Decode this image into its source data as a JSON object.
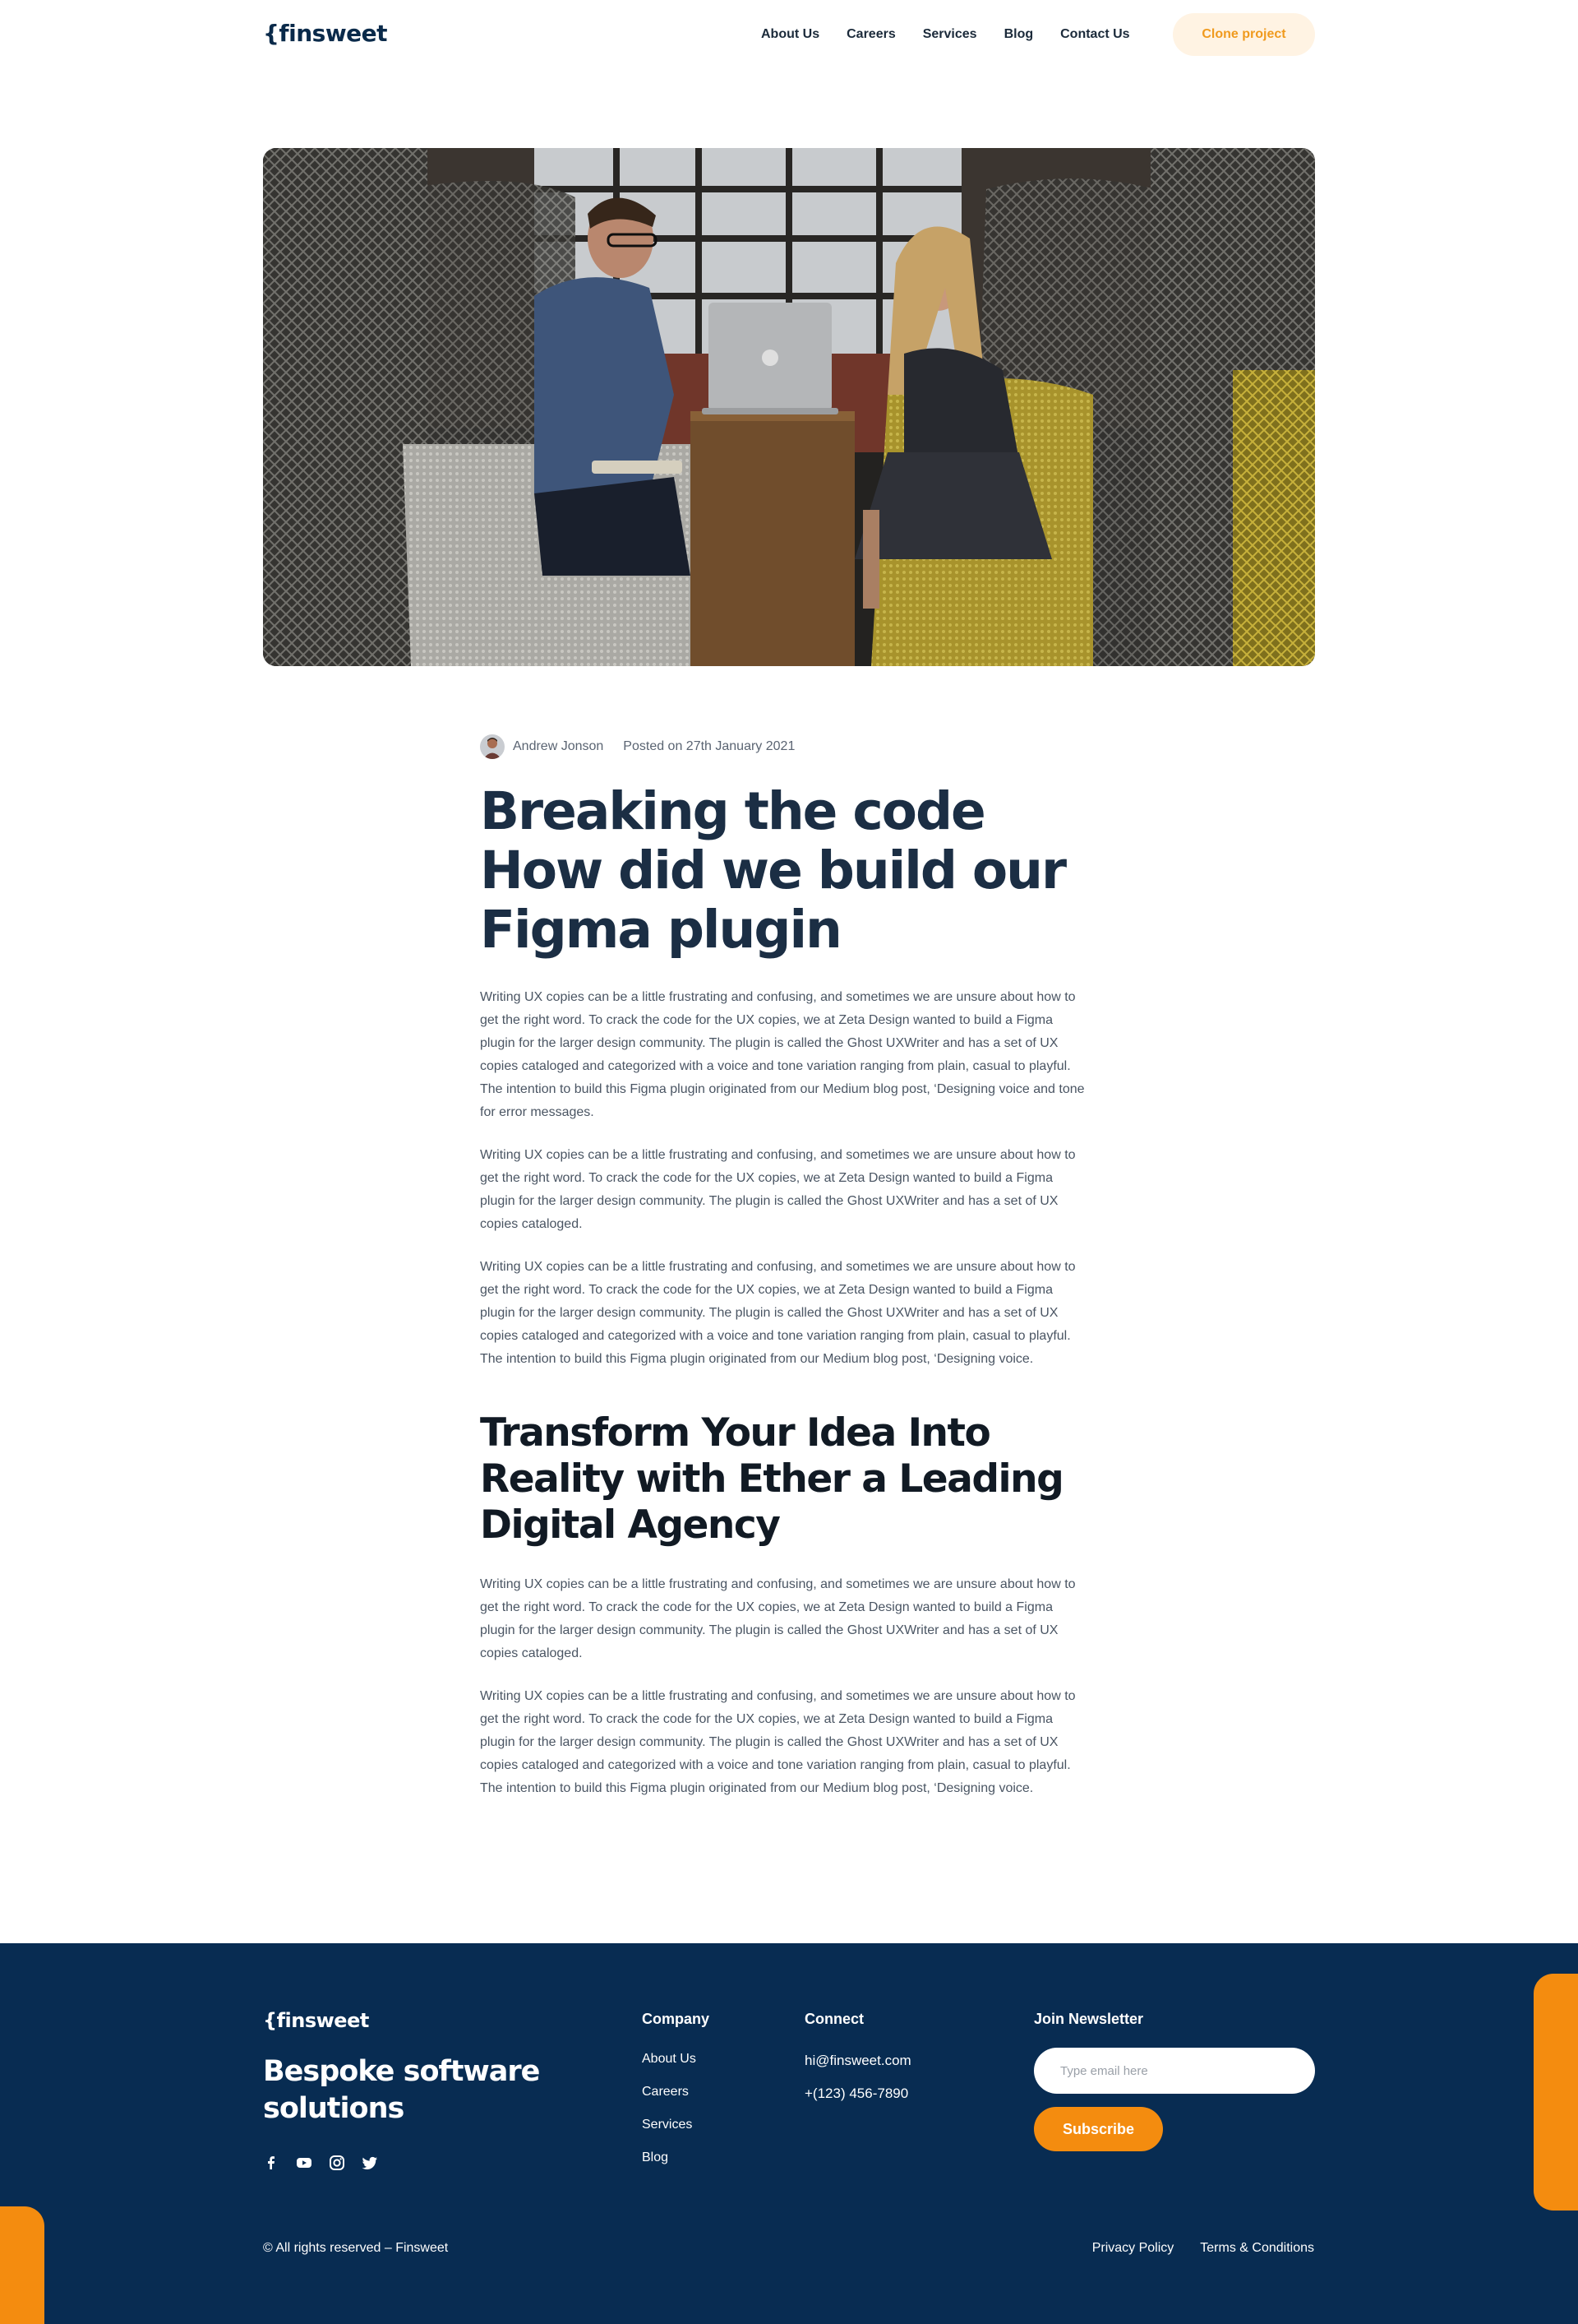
{
  "header": {
    "logo": "{finsweet",
    "nav": [
      "About Us",
      "Careers",
      "Services",
      "Blog",
      "Contact Us"
    ],
    "cta": "Clone project"
  },
  "hero": {
    "description": "photo"
  },
  "article": {
    "author": "Andrew Jonson",
    "posted": "Posted on 27th January 2021",
    "title": "Breaking the code How did we build our Figma plugin",
    "paragraphs": [
      "Writing UX copies can be a little frustrating and confusing, and sometimes we are unsure about how to get the right word. To crack the code for the UX copies, we at Zeta Design wanted to build a Figma plugin for the larger design community. The plugin is called the Ghost UXWriter and has a set of UX copies cataloged and categorized with a voice and tone variation ranging from plain, casual to playful. The intention to build this Figma plugin originated from our Medium blog post, ‘Designing voice and tone for error messages.",
      "Writing UX copies can be a little frustrating and confusing, and sometimes we are unsure about how to get the right word. To crack the code for the UX copies, we at Zeta Design wanted to build a Figma plugin for the larger design community. The plugin is called the Ghost UXWriter and has a set of UX copies cataloged.",
      "Writing UX copies can be a little frustrating and confusing, and sometimes we are unsure about how to get the right word. To crack the code for the UX copies, we at Zeta Design wanted to build a Figma plugin for the larger design community. The plugin is called the Ghost UXWriter and has a set of UX copies cataloged and categorized with a voice and tone variation ranging from plain, casual to playful. The intention to build this Figma plugin originated from our Medium blog post, ‘Designing voice."
    ],
    "subtitle": "Transform Your Idea Into Reality with Ether a Leading Digital Agency",
    "paragraphs2": [
      "Writing UX copies can be a little frustrating and confusing, and sometimes we are unsure about how to get the right word. To crack the code for the UX copies, we at Zeta Design wanted to build a Figma plugin for the larger design community. The plugin is called the Ghost UXWriter and has a set of UX copies cataloged.",
      "Writing UX copies can be a little frustrating and confusing, and sometimes we are unsure about how to get the right word. To crack the code for the UX copies, we at Zeta Design wanted to build a Figma plugin for the larger design community. The plugin is called the Ghost UXWriter and has a set of UX copies cataloged and categorized with a voice and tone variation ranging from plain, casual to playful. The intention to build this Figma plugin originated from our Medium blog post, ‘Designing voice."
    ]
  },
  "footer": {
    "logo": "{finsweet",
    "tagline": "Bespoke software solutions",
    "socials": [
      "facebook-icon",
      "youtube-icon",
      "instagram-icon",
      "twitter-icon"
    ],
    "company": {
      "heading": "Company",
      "links": [
        "About Us",
        "Careers",
        "Services",
        "Blog"
      ]
    },
    "connect": {
      "heading": "Connect",
      "email": "hi@finsweet.com",
      "phone": "+(123) 456-7890"
    },
    "newsletter": {
      "heading": "Join Newsletter",
      "placeholder": "Type email here",
      "button": "Subscribe"
    },
    "copyright": "© All rights reserved – Finsweet",
    "legal": [
      "Privacy Policy",
      "Terms & Conditions"
    ]
  },
  "colors": {
    "brand_dark": "#082c52",
    "accent": "#f48c0f",
    "cta_bg": "#fff3e3",
    "cta_text": "#f09a1e"
  }
}
